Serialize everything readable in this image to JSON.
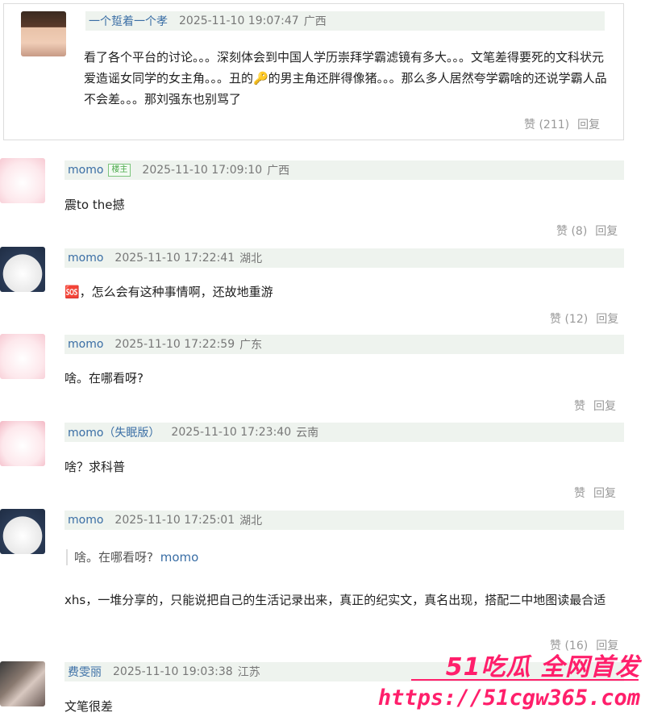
{
  "comments": [
    {
      "author": "一个踅着一个孝",
      "datetime": "2025-11-10 19:07:47",
      "location": "广西",
      "text": "看了各个平台的讨论。。。深刻体会到中国人学历崇拜学霸滤镜有多大。。。文笔差得要死的文科状元爱造谣女同学的女主角。。。丑的🔑的男主角还胖得像猪。。。那么多人居然夸学霸啥的还说学霸人品不会差。。。那刘强东也别骂了",
      "likes": "赞 (211)",
      "reply": "回复"
    },
    {
      "author": "momo",
      "tag": "楼主",
      "datetime": "2025-11-10 17:09:10",
      "location": "广西",
      "text": "震to the撼",
      "likes": "赞 (8)",
      "reply": "回复"
    },
    {
      "author": "momo",
      "datetime": "2025-11-10 17:22:41",
      "location": "湖北",
      "text": "🆘，怎么会有这种事情啊，还故地重游",
      "likes": "赞 (12)",
      "reply": "回复"
    },
    {
      "author": "momo",
      "datetime": "2025-11-10 17:22:59",
      "location": "广东",
      "text": "啥。在哪看呀?",
      "likes": "赞",
      "reply": "回复"
    },
    {
      "author": "momo（失眠版）",
      "datetime": "2025-11-10 17:23:40",
      "location": "云南",
      "text": "啥？求科普",
      "likes": "赞",
      "reply": "回复"
    },
    {
      "author": "momo",
      "datetime": "2025-11-10 17:25:01",
      "location": "湖北",
      "quote_text": "啥。在哪看呀?",
      "quote_author": "momo",
      "text": "xhs，一堆分享的，只能说把自己的生活记录出来，真正的纪实文，真名出现，搭配二中地图读最合适",
      "likes": "赞 (16)",
      "reply": "回复"
    },
    {
      "author": "费雯丽",
      "datetime": "2025-11-10 19:03:38",
      "location": "江苏",
      "text": "文笔很差"
    }
  ],
  "watermark": {
    "title": "51吃瓜 全网首发",
    "url": "https://51cgw365.com"
  }
}
